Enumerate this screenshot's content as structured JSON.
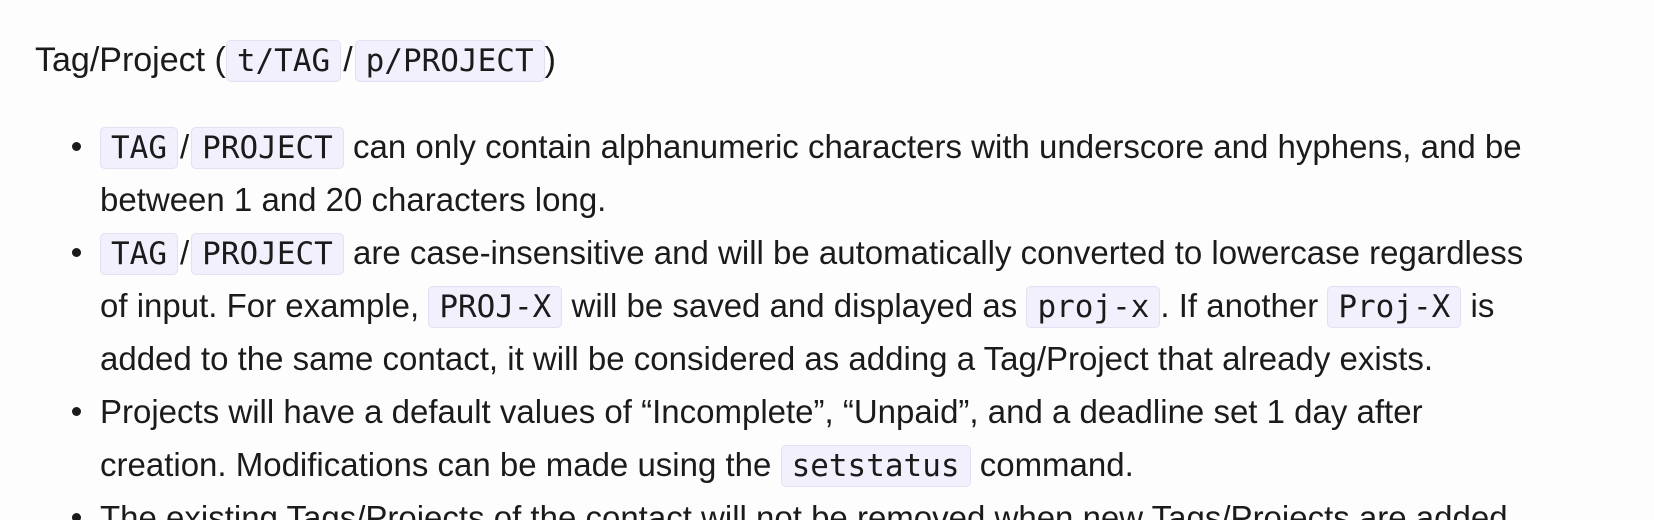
{
  "heading": {
    "prefix": "Tag/Project (",
    "code_tag": "t/TAG",
    "slash": "/",
    "code_project": "p/PROJECT",
    "suffix": ")"
  },
  "rules": [
    {
      "code_a": "TAG",
      "slash": "/",
      "code_b": "PROJECT",
      "text_1": " can only contain alphanumeric characters with underscore and hyphens, and be",
      "text_2": "between 1 and 20 characters long."
    },
    {
      "code_a": "TAG",
      "slash": "/",
      "code_b": "PROJECT",
      "text_1": " are case-insensitive and will be automatically converted to lowercase regardless",
      "text_2a": "of input. For example, ",
      "code_c": "PROJ-X",
      "text_2b": " will be saved and displayed as ",
      "code_d": "proj-x",
      "text_2c": ". If another ",
      "code_e": "Proj-X",
      "text_2d": " is",
      "text_3": "added to the same contact, it will be considered as adding a Tag/Project that already exists."
    },
    {
      "text_1": "Projects will have a default values of “Incomplete”, “Unpaid”, and a deadline set 1 day after",
      "text_2a": "creation. Modifications can be made using the ",
      "code_a": "setstatus",
      "text_2b": " command."
    },
    {
      "text_1": "The existing Tags/Projects of the contact will not be removed when new Tags/Projects are added."
    }
  ]
}
